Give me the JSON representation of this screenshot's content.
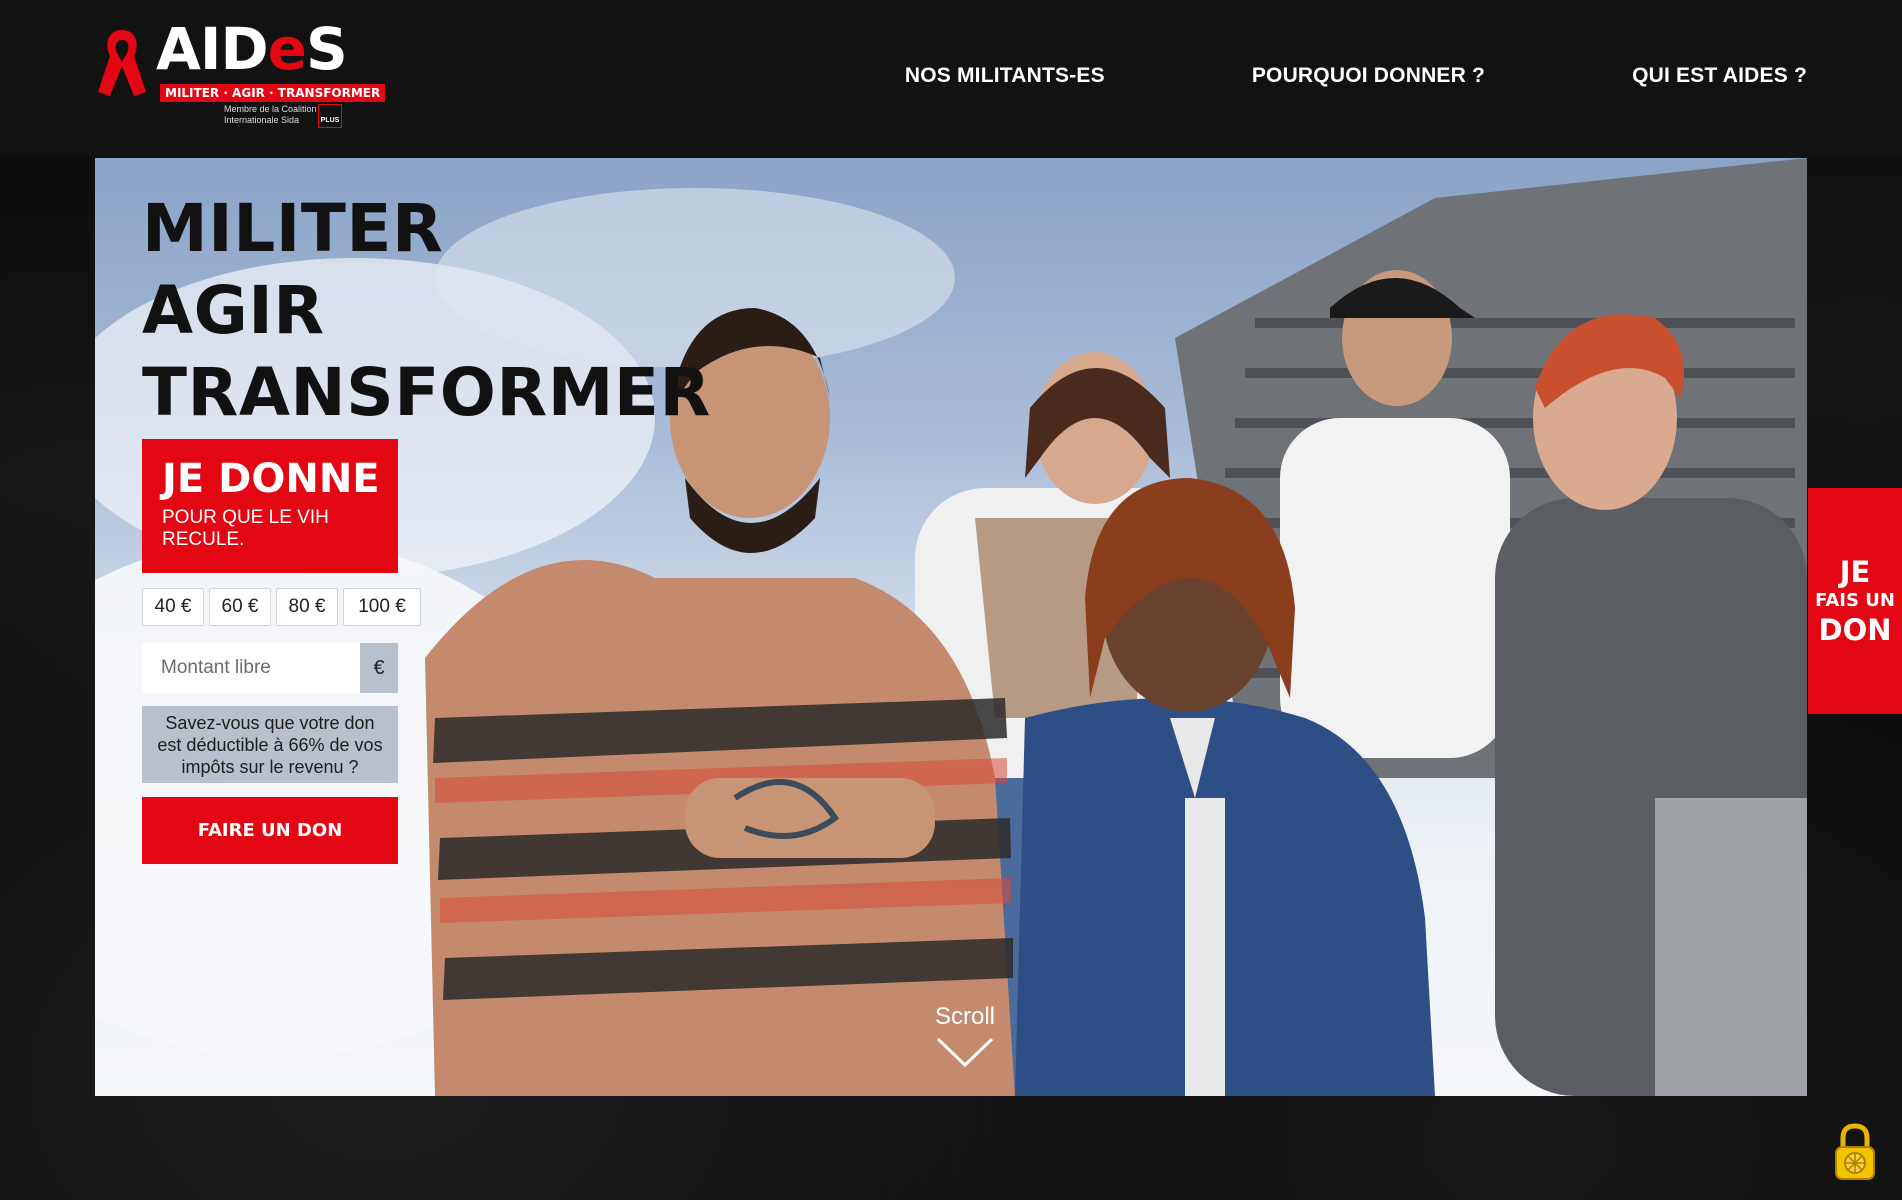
{
  "logo": {
    "wordmark_prefix": "AID",
    "wordmark_e": "e",
    "wordmark_suffix": "S",
    "tagline": "MILITER · AGIR · TRANSFORMER",
    "coalition_line1": "Membre de la Coalition",
    "coalition_line2": "Internationale Sida",
    "plus_badge": "PLUS"
  },
  "nav": {
    "items": [
      {
        "label": "NOS MILITANTS-ES"
      },
      {
        "label": "POURQUOI DONNER ?"
      },
      {
        "label": "QUI EST AIDES ?"
      }
    ]
  },
  "hero": {
    "title_lines": [
      "MILITER",
      "AGIR",
      "TRANSFORMER"
    ],
    "donate": {
      "title": "JE DONNE",
      "subtitle": "POUR QUE LE VIH RECULE."
    },
    "amounts": [
      "40 €",
      "60 €",
      "80 €",
      "100 €"
    ],
    "free_amount": {
      "placeholder": "Montant libre",
      "currency": "€"
    },
    "tax_info": "Savez-vous que votre don est déductible à 66% de vos impôts sur le revenu ?",
    "cta_label": "FAIRE UN DON",
    "scroll_label": "Scroll"
  },
  "side_tab": {
    "line1": "JE",
    "line2": "FAIS UN",
    "line3": "DON"
  },
  "colors": {
    "brand_red": "#e30613",
    "header_bg": "#121212",
    "info_grey": "#b7c0cb"
  },
  "icons": {
    "logo_ribbon": "red-ribbon-icon",
    "scroll": "chevron-down-icon",
    "privacy": "padlock-icon"
  }
}
